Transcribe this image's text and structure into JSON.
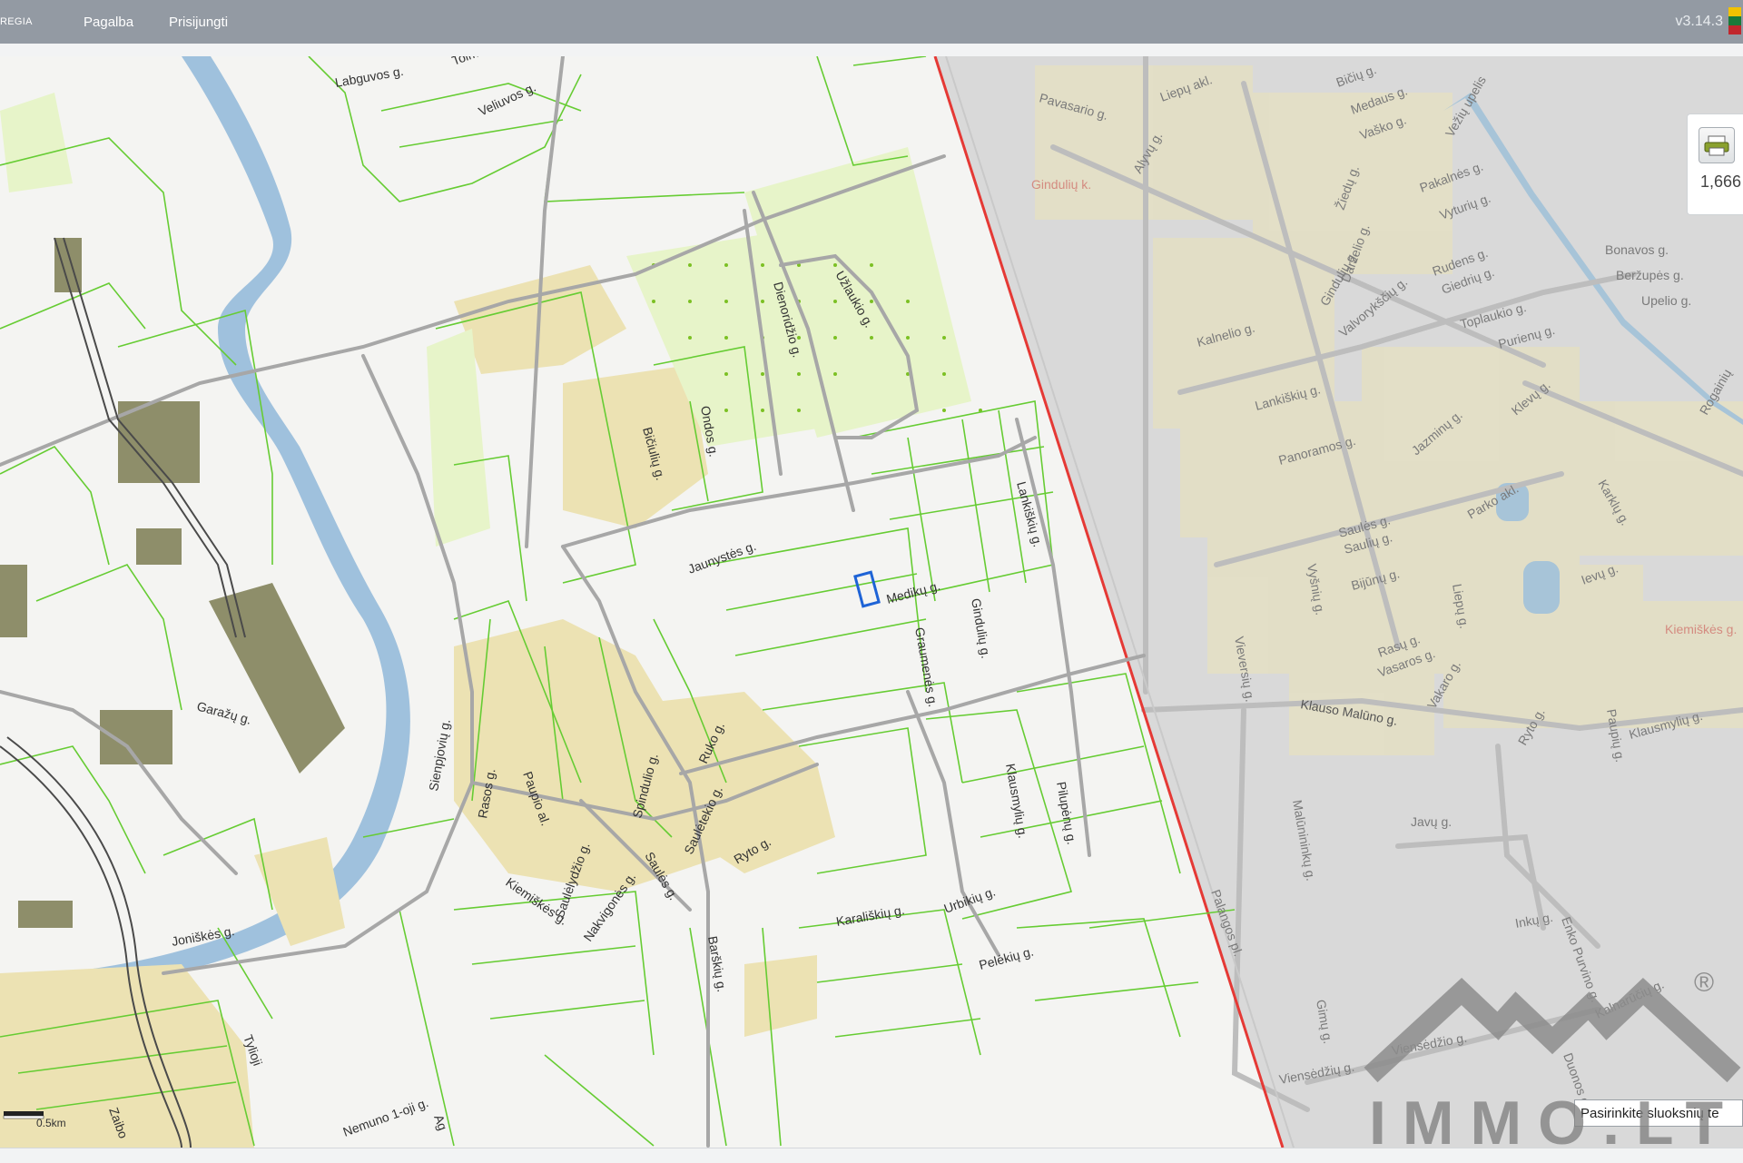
{
  "topbar": {
    "brand": "REGIA",
    "menu": [
      "Pagalba",
      "Prisijungti"
    ],
    "version": "v3.14.3"
  },
  "print_widget": {
    "icon": "printer-icon",
    "value": "1,666"
  },
  "layer_select": {
    "value": "Pasirinkite sluoksnių te"
  },
  "scale": {
    "label": "0.5km"
  },
  "watermark": {
    "text": "IMMO.LT",
    "registered": "®"
  },
  "map": {
    "left_labels": [
      "Labguvos g.",
      "Tolmi",
      "Veliuvos g.",
      "Garažų g.",
      "Joniškės g.",
      "Tylioji",
      "Zaibo",
      "Nemuno 1-oji g.",
      "Ag",
      "Sienpjovių g.",
      "Rasos g.",
      "Paupio al.",
      "Saulėlydžio g.",
      "Kiemiškės g.",
      "Nakvigonės g.",
      "Spindulio g.",
      "Saulės g.",
      "Saulėtekio g.",
      "Ryto g.",
      "Ruko g.",
      "Bičiulių g.",
      "Ondos g.",
      "Jaunystės g.",
      "Dienoridžio g.",
      "Užlaukio g.",
      "Medikų g.",
      "Graumenės g.",
      "Gindulių g.",
      "Lankiškių g.",
      "Klausmylių g.",
      "Pilupėnų g.",
      "Karališkių g.",
      "Urbikių g.",
      "Pelėkių g.",
      "Barškių g."
    ],
    "right_labels": [
      "Pavasario g.",
      "Liepų akl.",
      "Bičių g.",
      "Medaus g.",
      "Vaško g.",
      "Vežių upelis",
      "Gindulių k.",
      "Alyvų g.",
      "Pakalnės g.",
      "Vyturių g.",
      "Žiedų g.",
      "Darželio g.",
      "Gindulių g.",
      "Rudens g.",
      "Giedrių g.",
      "Bonavos g.",
      "Beržupės g.",
      "Upelio g.",
      "Valvorykščių g.",
      "Toplaukio g.",
      "Purienų g.",
      "Kalnelio g.",
      "Lankiškių g.",
      "Panoramos g.",
      "Jazminų g.",
      "Klevų g.",
      "Karklų g.",
      "Rogainių",
      "Saulės g.",
      "Saulių g.",
      "Parko akl.",
      "Bijūnų g.",
      "Liepų g.",
      "Ievų g.",
      "Vyšnių g.",
      "Vieversių g.",
      "Rasų g.",
      "Vasaros g.",
      "Vakaro g.",
      "Ryto g.",
      "Paupių g.",
      "Kiemiškės g.",
      "Klausmylių g.",
      "Klauso Malūno g.",
      "Malūnininkų g.",
      "Javų g.",
      "Enko Purvino g.",
      "Inkų g.",
      "Kalnarūčių g.",
      "Gimų g.",
      "Viensėdžių g.",
      "Viensėdžio g.",
      "Palangos pl.",
      "Duonos g."
    ]
  }
}
